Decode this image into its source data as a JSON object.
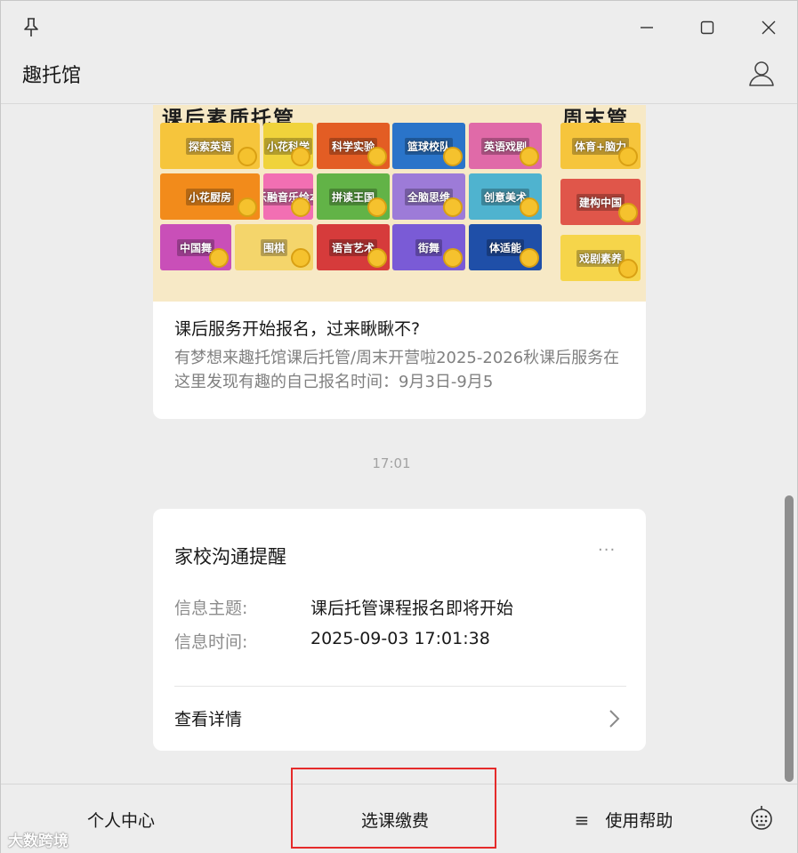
{
  "window": {
    "app_title": "趣托馆",
    "controls": [
      "pin-icon",
      "minimize-icon",
      "maximize-icon",
      "close-icon"
    ]
  },
  "article": {
    "banner": {
      "left_heading": "课后素质托管",
      "right_heading": "周末管",
      "tiles": [
        {
          "label": "探索英语",
          "color": "#f6c53c"
        },
        {
          "label": "小花科学",
          "color": "#f0d33b"
        },
        {
          "label": "科学实验",
          "color": "#e35d24"
        },
        {
          "label": "篮球校队",
          "color": "#2a74c9"
        },
        {
          "label": "英语戏剧",
          "color": "#e06aa8"
        },
        {
          "label": "小花厨房",
          "color": "#f28b1b"
        },
        {
          "label": "乐融音乐绘本",
          "color": "#f26fb3"
        },
        {
          "label": "拼读王国",
          "color": "#62b347"
        },
        {
          "label": "全脑思维",
          "color": "#9d7bd8"
        },
        {
          "label": "创意美术",
          "color": "#4fb3cf"
        },
        {
          "label": "中国舞",
          "color": "#c94fb8"
        },
        {
          "label": "围棋",
          "color": "#f4d56b"
        },
        {
          "label": "语言艺术",
          "color": "#d63b3b"
        },
        {
          "label": "街舞",
          "color": "#7a5bd6"
        },
        {
          "label": "体适能",
          "color": "#1f4fa8"
        },
        {
          "label": "体育+脑力",
          "color": "#f6c53c"
        },
        {
          "label": "建构中国",
          "color": "#e0564a"
        },
        {
          "label": "戏剧素养",
          "color": "#f6d54a"
        }
      ]
    },
    "title": "课后服务开始报名，过来瞅瞅不?",
    "description": "有梦想来趣托馆课后托管/周末开营啦2025-2026秋课后服务在这里发现有趣的自己报名时间：9月3日-9月5"
  },
  "timestamp": "17:01",
  "notice": {
    "title": "家校沟通提醒",
    "more": "···",
    "subject_label": "信息主题:",
    "subject_value": "课后托管课程报名即将开始",
    "time_label": "信息时间:",
    "time_value": "2025-09-03 17:01:38",
    "detail_link": "查看详情"
  },
  "bottom_menu": {
    "items": [
      {
        "label": "个人中心"
      },
      {
        "label": "选课缴费"
      },
      {
        "label": "使用帮助",
        "icon": "≡"
      }
    ]
  },
  "watermark": "大数跨境",
  "colors": {
    "background": "#ededed",
    "card": "#ffffff",
    "highlight_border": "#e52b2b",
    "muted_text": "#808080"
  }
}
